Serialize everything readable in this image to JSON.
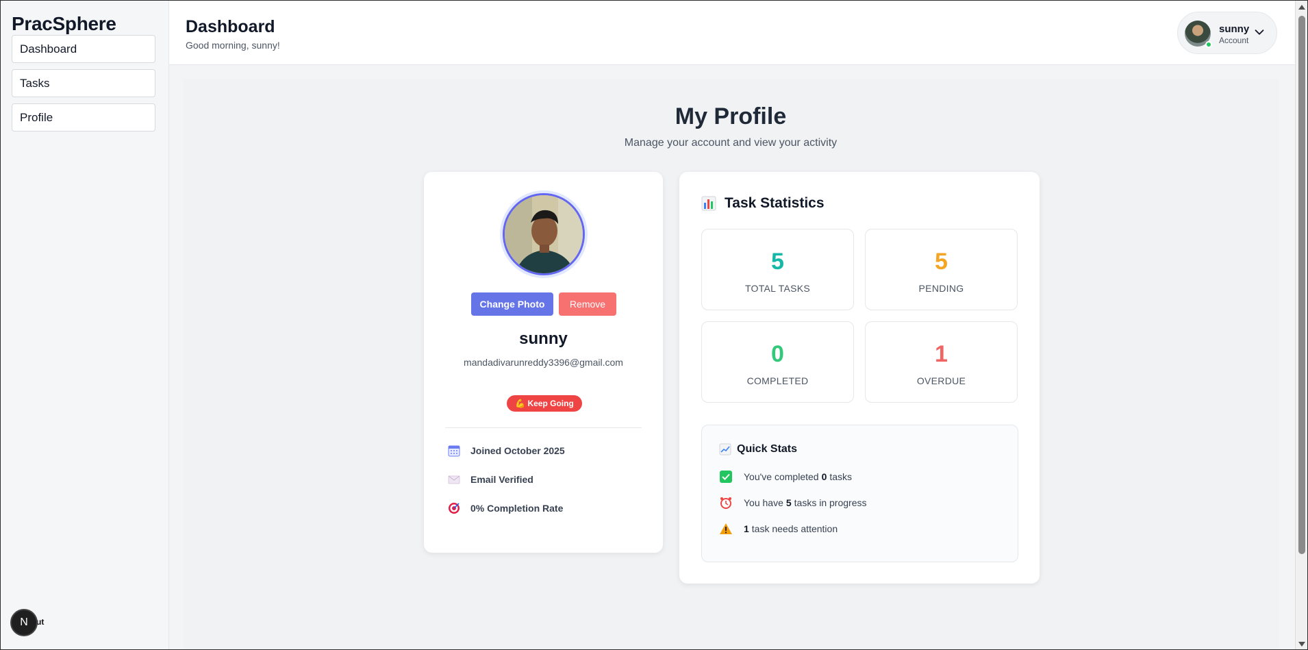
{
  "app": {
    "brand": "PracSphere"
  },
  "sidebar": {
    "items": [
      {
        "label": "Dashboard"
      },
      {
        "label": "Tasks"
      },
      {
        "label": "Profile"
      }
    ],
    "logout_icon": "N",
    "logout_text": "ut"
  },
  "header": {
    "title": "Dashboard",
    "greeting": "Good morning, sunny!",
    "account": {
      "name": "sunny",
      "role": "Account",
      "status_color": "#22c55e"
    }
  },
  "page": {
    "title": "My Profile",
    "subtitle": "Manage your account and view your activity"
  },
  "profile": {
    "change_photo_label": "Change Photo",
    "remove_label": "Remove",
    "name": "sunny",
    "email": "mandadivarunreddy3396@gmail.com",
    "badge": "💪 Keep Going",
    "info": [
      {
        "icon": "calendar-icon",
        "label": "Joined October 2025"
      },
      {
        "icon": "envelope-icon",
        "label": "Email Verified"
      },
      {
        "icon": "target-icon",
        "label": "0% Completion Rate"
      }
    ]
  },
  "stats": {
    "title": "Task Statistics",
    "boxes": [
      {
        "value": "5",
        "caption": "TOTAL TASKS",
        "color": "#14b8a6"
      },
      {
        "value": "5",
        "caption": "PENDING",
        "color": "#f5a524"
      },
      {
        "value": "0",
        "caption": "COMPLETED",
        "color": "#34c97a"
      },
      {
        "value": "1",
        "caption": "OVERDUE",
        "color": "#f06464"
      }
    ],
    "quick": {
      "title": "Quick Stats",
      "rows": [
        {
          "pre": "You've completed",
          "value": "0",
          "post": "tasks"
        },
        {
          "pre": "You have",
          "value": "5",
          "post": "tasks in progress"
        },
        {
          "pre": "",
          "value": "1",
          "post": "task needs attention"
        }
      ]
    }
  }
}
